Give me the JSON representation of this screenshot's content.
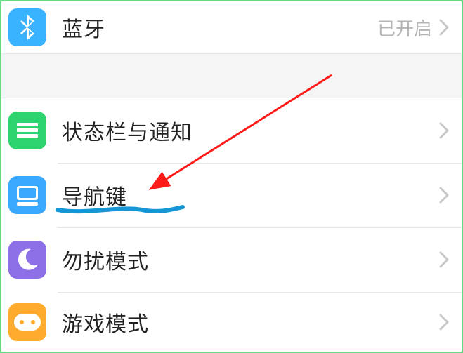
{
  "rows": {
    "bluetooth": {
      "label": "蓝牙",
      "value": "已开启"
    },
    "status_notif": {
      "label": "状态栏与通知"
    },
    "nav_key": {
      "label": "导航键"
    },
    "dnd": {
      "label": "勿扰模式"
    },
    "game": {
      "label": "游戏模式"
    }
  },
  "colors": {
    "accent_blue": "#39b3ff",
    "accent_green": "#2dd36f",
    "accent_blue2": "#39a9ff",
    "accent_purple": "#8d6fe8",
    "accent_orange": "#ffab2e"
  }
}
